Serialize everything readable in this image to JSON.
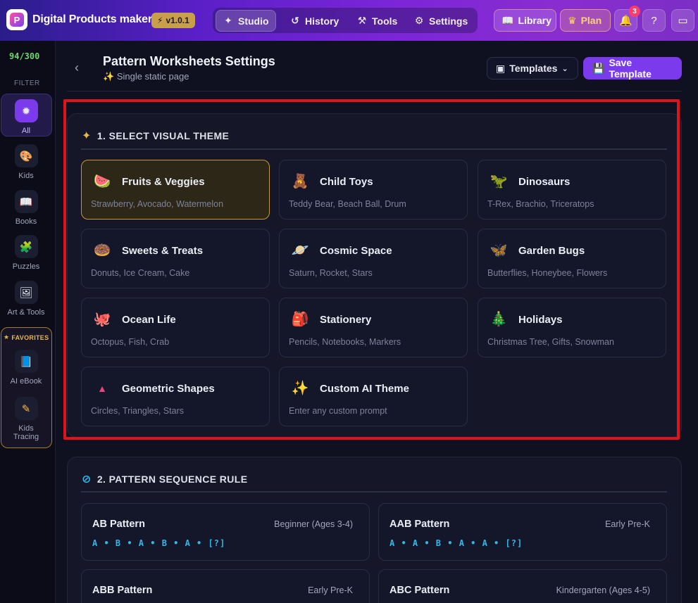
{
  "app": {
    "title": "Digital Products maker",
    "version": "v1.0.1",
    "logo_letter": "P"
  },
  "nav": {
    "studio": "Studio",
    "history": "History",
    "tools": "Tools",
    "settings": "Settings",
    "library": "Library",
    "plan": "Plan",
    "notifications_count": "3"
  },
  "sidebar": {
    "credits": "94/300",
    "filter_label": "FILTER",
    "items": [
      {
        "label": "All",
        "icon": "sparkle-icon"
      },
      {
        "label": "Kids",
        "icon": "palette-icon"
      },
      {
        "label": "Books",
        "icon": "book-icon"
      },
      {
        "label": "Puzzles",
        "icon": "puzzle-icon"
      },
      {
        "label": "Art & Tools",
        "icon": "picture-icon"
      }
    ],
    "favorites_label": "FAVORITES",
    "favorites": [
      {
        "label": "AI eBook",
        "icon": "open-book-icon"
      },
      {
        "label": "Kids Tracing",
        "icon": "pen-tool-icon"
      }
    ]
  },
  "header": {
    "title": "Pattern Worksheets Settings",
    "subtitle": "Single static page",
    "templates_label": "Templates",
    "save_label": "Save Template"
  },
  "section1": {
    "title": "1. SELECT VISUAL THEME",
    "themes": [
      {
        "name": "Fruits & Veggies",
        "desc": "Strawberry, Avocado, Watermelon",
        "emoji": "🍉",
        "selected": true
      },
      {
        "name": "Child Toys",
        "desc": "Teddy Bear, Beach Ball, Drum",
        "emoji": "🧸"
      },
      {
        "name": "Dinosaurs",
        "desc": "T-Rex, Brachio, Triceratops",
        "emoji": "🦖"
      },
      {
        "name": "Sweets & Treats",
        "desc": "Donuts, Ice Cream, Cake",
        "emoji": "🍩"
      },
      {
        "name": "Cosmic Space",
        "desc": "Saturn, Rocket, Stars",
        "emoji": "🪐"
      },
      {
        "name": "Garden Bugs",
        "desc": "Butterflies, Honeybee, Flowers",
        "emoji": "🦋"
      },
      {
        "name": "Ocean Life",
        "desc": "Octopus, Fish, Crab",
        "emoji": "🐙"
      },
      {
        "name": "Stationery",
        "desc": "Pencils, Notebooks, Markers",
        "emoji": "🎒"
      },
      {
        "name": "Holidays",
        "desc": "Christmas Tree, Gifts, Snowman",
        "emoji": "🎄"
      },
      {
        "name": "Geometric Shapes",
        "desc": "Circles, Triangles, Stars",
        "emoji": "▲"
      },
      {
        "name": "Custom AI Theme",
        "desc": "Enter any custom prompt",
        "emoji": "✨"
      }
    ]
  },
  "section2": {
    "title": "2. PATTERN SEQUENCE RULE",
    "patterns": [
      {
        "name": "AB Pattern",
        "level": "Beginner (Ages 3-4)",
        "sequence": "A • B • A • B • A • [?]"
      },
      {
        "name": "AAB Pattern",
        "level": "Early Pre-K",
        "sequence": "A • A • B • A • A • [?]"
      },
      {
        "name": "ABB Pattern",
        "level": "Early Pre-K",
        "sequence": ""
      },
      {
        "name": "ABC Pattern",
        "level": "Kindergarten (Ages 4-5)",
        "sequence": ""
      }
    ]
  },
  "colors": {
    "accent": "#7c3aed",
    "highlight": "#e0121c",
    "selected_border": "#c9953a",
    "sequence": "#2fb8e8"
  }
}
